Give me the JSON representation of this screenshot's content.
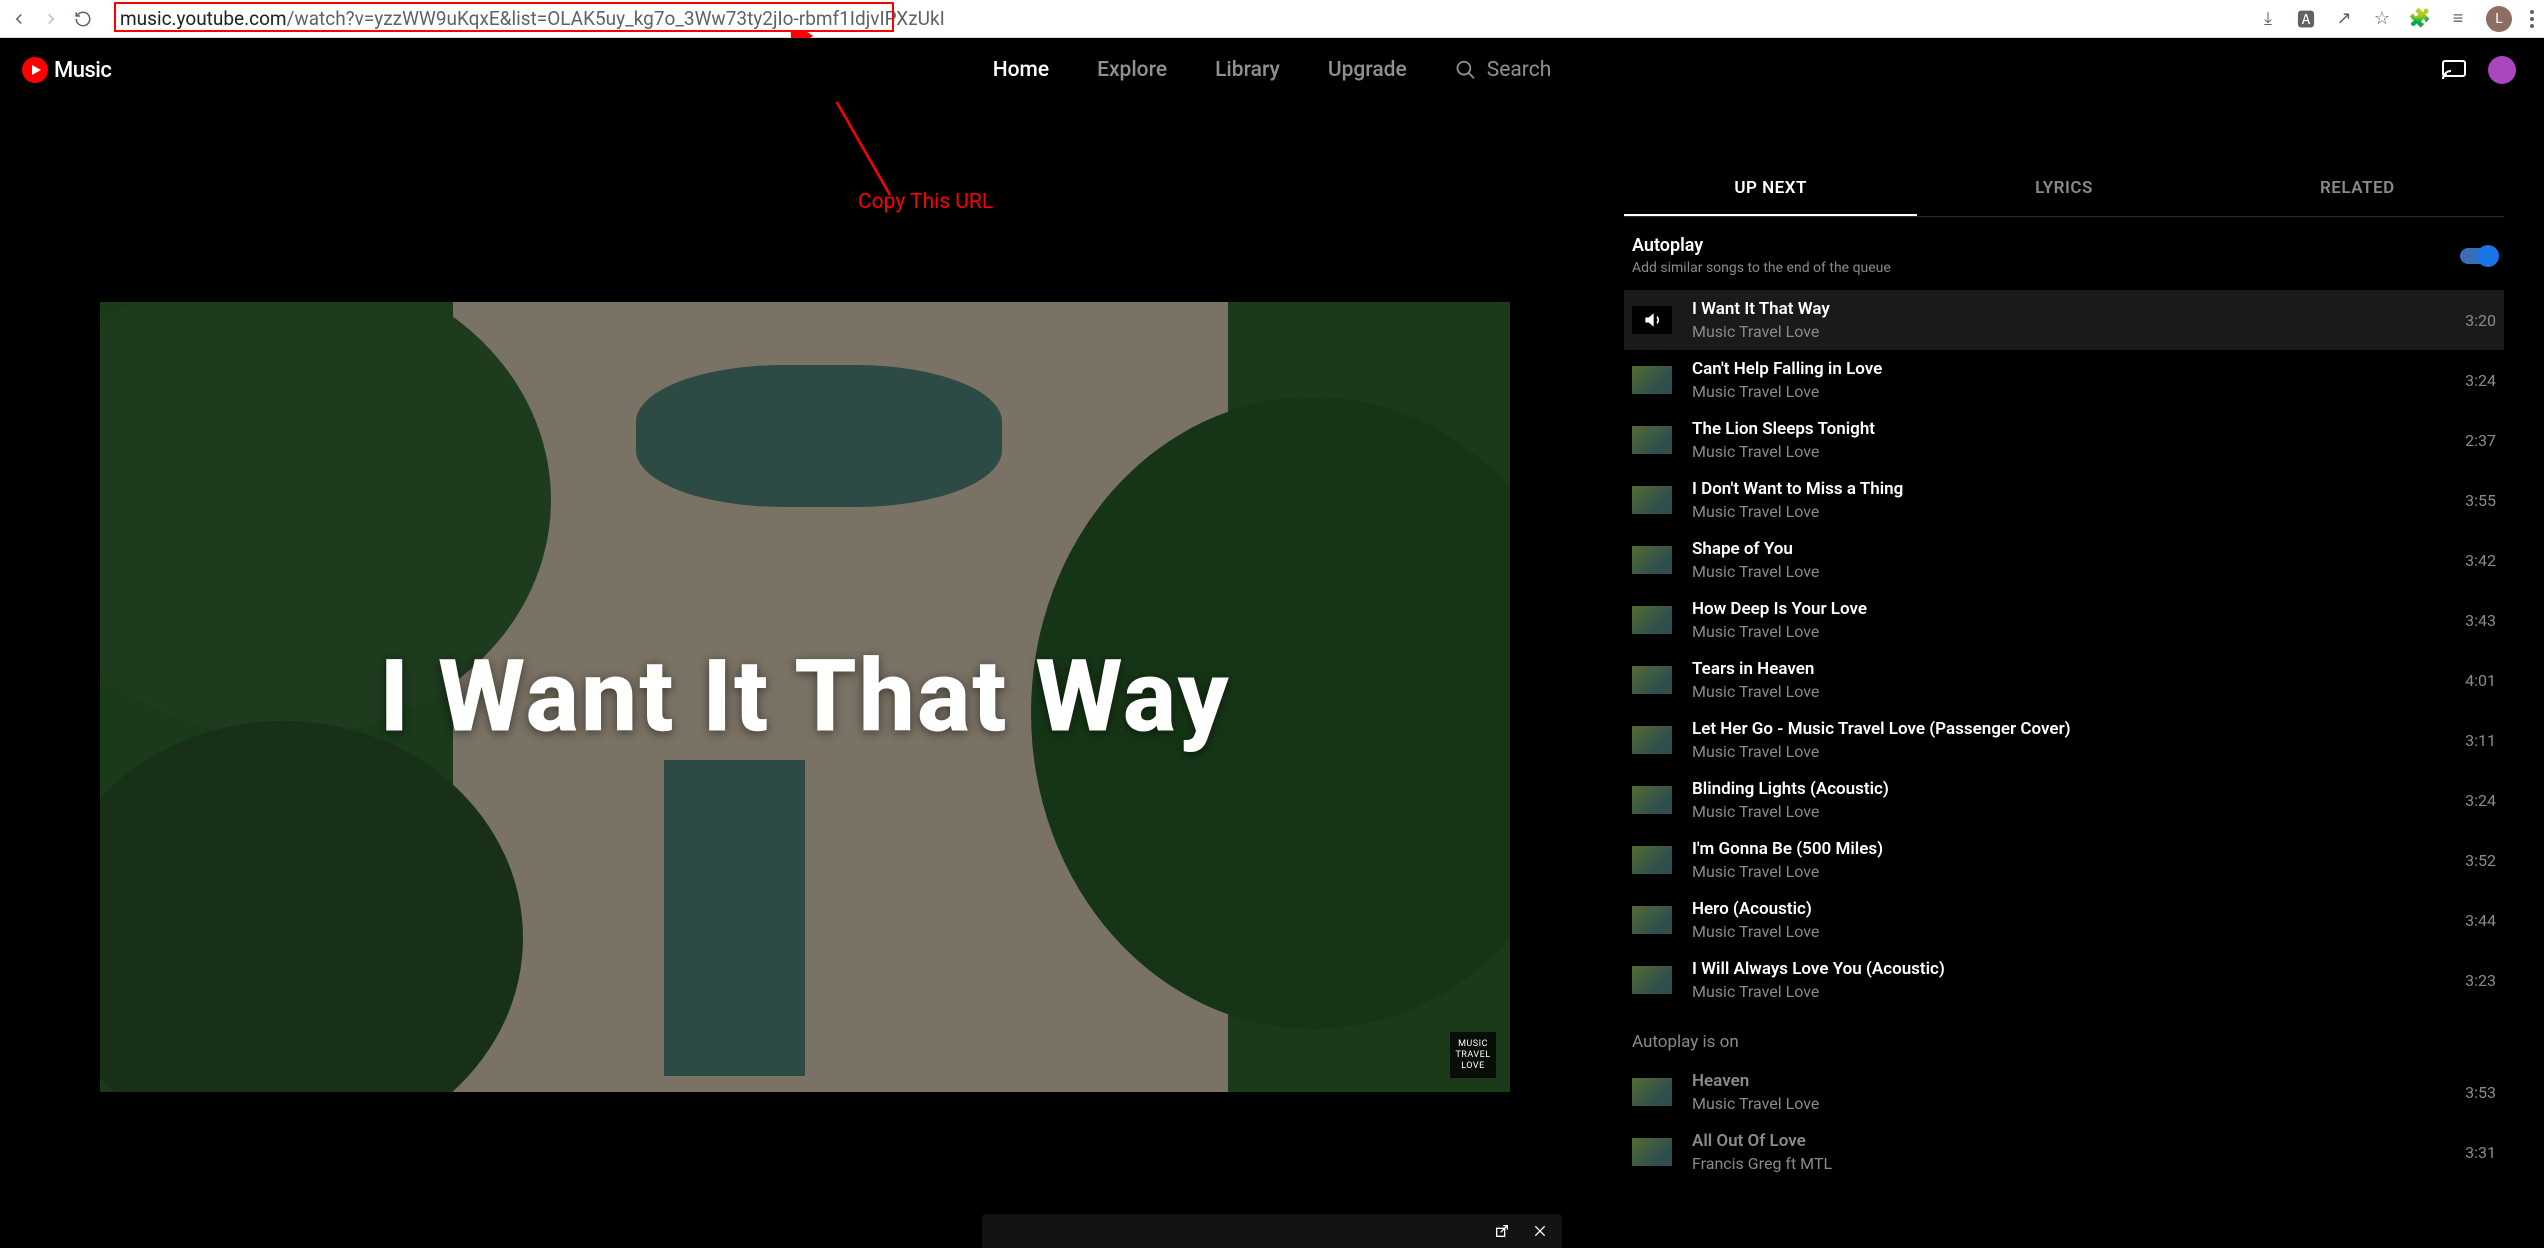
{
  "browser": {
    "url_host": "music.youtube.com",
    "url_path": "/watch?v=yzzWW9uKqxE&list=OLAK5uy_kg7o_3Ww73ty2jIo-rbmf1IdjvIPXzUkI",
    "avatar_initial": "L"
  },
  "annotation": {
    "text": "Copy This URL"
  },
  "header": {
    "brand": "Music",
    "nav": {
      "home": "Home",
      "explore": "Explore",
      "library": "Library",
      "upgrade": "Upgrade"
    },
    "search_label": "Search"
  },
  "tabs": {
    "upnext": "UP NEXT",
    "lyrics": "LYRICS",
    "related": "RELATED"
  },
  "autoplay": {
    "title": "Autoplay",
    "subtitle": "Add similar songs to the end of the queue",
    "status_header": "Autoplay is on"
  },
  "video": {
    "title_overlay": "I Want It That Way",
    "badge_l1": "MUSIC",
    "badge_l2": "TRAVEL",
    "badge_l3": "LOVE"
  },
  "queue": [
    {
      "title": "I Want It That Way",
      "artist": "Music Travel Love",
      "dur": "3:20",
      "playing": true
    },
    {
      "title": "Can't Help Falling in Love",
      "artist": "Music Travel Love",
      "dur": "3:24"
    },
    {
      "title": "The Lion Sleeps Tonight",
      "artist": "Music Travel Love",
      "dur": "2:37"
    },
    {
      "title": "I Don't Want to Miss a Thing",
      "artist": "Music Travel Love",
      "dur": "3:55"
    },
    {
      "title": "Shape of You",
      "artist": "Music Travel Love",
      "dur": "3:42"
    },
    {
      "title": "How Deep Is Your Love",
      "artist": "Music Travel Love",
      "dur": "3:43"
    },
    {
      "title": "Tears in Heaven",
      "artist": "Music Travel Love",
      "dur": "4:01"
    },
    {
      "title": "Let Her Go - Music Travel Love (Passenger Cover)",
      "artist": "Music Travel Love",
      "dur": "3:11"
    },
    {
      "title": "Blinding Lights (Acoustic)",
      "artist": "Music Travel Love",
      "dur": "3:24"
    },
    {
      "title": "I'm Gonna Be (500 Miles)",
      "artist": "Music Travel Love",
      "dur": "3:52"
    },
    {
      "title": "Hero (Acoustic)",
      "artist": "Music Travel Love",
      "dur": "3:44"
    },
    {
      "title": "I Will Always Love You (Acoustic)",
      "artist": "Music Travel Love",
      "dur": "3:23"
    }
  ],
  "autoplay_queue": [
    {
      "title": "Heaven",
      "artist": "Music Travel Love",
      "dur": "3:53"
    },
    {
      "title": "All Out Of Love",
      "artist": "Francis Greg ft MTL",
      "dur": "3:31"
    }
  ]
}
